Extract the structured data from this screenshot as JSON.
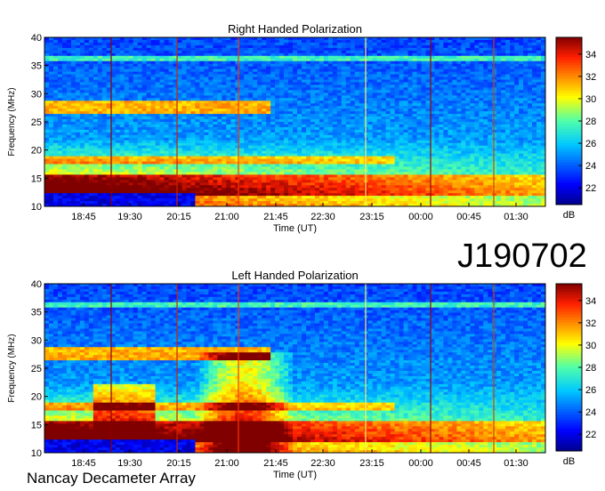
{
  "chart_data": [
    {
      "type": "heatmap",
      "title": "Right Handed Polarization",
      "xlabel": "Time (UT)",
      "ylabel": "Frequency (MHz)",
      "x_ticks": [
        "18:45",
        "19:30",
        "20:15",
        "21:00",
        "21:45",
        "22:30",
        "23:15",
        "00:00",
        "00:45",
        "01:30"
      ],
      "y_ticks": [
        10,
        15,
        20,
        25,
        30,
        35,
        40
      ],
      "ylim": [
        10,
        40
      ],
      "colorbar": {
        "label": "dB",
        "ticks": [
          22,
          24,
          26,
          28,
          30,
          32,
          34
        ],
        "range": [
          20.5,
          35.5
        ]
      }
    },
    {
      "type": "heatmap",
      "title": "Left Handed Polarization",
      "xlabel": "Time (UT)",
      "ylabel": "Frequency (MHz)",
      "x_ticks": [
        "18:45",
        "19:30",
        "20:15",
        "21:00",
        "21:45",
        "22:30",
        "23:15",
        "00:00",
        "00:45",
        "01:30"
      ],
      "y_ticks": [
        10,
        15,
        20,
        25,
        30,
        35,
        40
      ],
      "ylim": [
        10,
        40
      ],
      "colorbar": {
        "label": "dB",
        "ticks": [
          22,
          24,
          26,
          28,
          30,
          32,
          34
        ],
        "range": [
          20.5,
          35.5
        ]
      }
    }
  ],
  "observation_id": "J190702",
  "footer": "Nancay Decameter Array"
}
